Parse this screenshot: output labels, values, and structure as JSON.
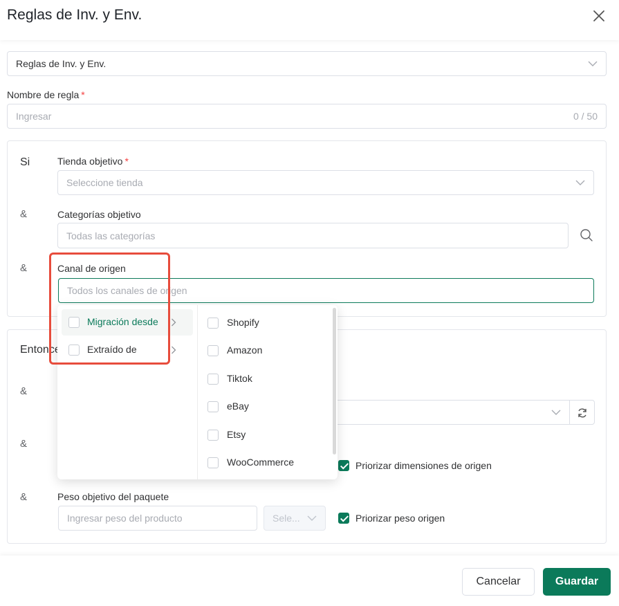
{
  "modal": {
    "title": "Reglas de Inv. y Env."
  },
  "rule_type": {
    "value": "Reglas de Inv. y Env."
  },
  "rule_name": {
    "label": "Nombre de regla",
    "required_mark": "*",
    "placeholder": "Ingresar",
    "counter": "0 / 50"
  },
  "if_section": {
    "label": "Si",
    "store": {
      "label": "Tienda objetivo",
      "required_mark": "*",
      "placeholder": "Seleccione tienda"
    },
    "categories": {
      "prefix": "&",
      "label": "Categorías objetivo",
      "placeholder": "Todas las categorías"
    },
    "channel": {
      "prefix": "&",
      "label": "Canal de origen",
      "placeholder": "Todos los canales de origen"
    }
  },
  "then_section": {
    "label": "Entonces",
    "row1_prefix": "&",
    "row2_prefix": "&",
    "prioritize_dimensions": {
      "label": "Priorizar dimensiones de origen",
      "checked": true
    },
    "weight": {
      "prefix": "&",
      "label": "Peso objetivo del paquete",
      "placeholder": "Ingresar peso del producto",
      "unit_placeholder": "Sele...",
      "prioritize_label": "Priorizar peso origen",
      "prioritize_checked": true
    }
  },
  "channel_dropdown": {
    "groups": [
      {
        "label": "Migración desde",
        "active": true,
        "checked": false
      },
      {
        "label": "Extraído de",
        "active": false,
        "checked": false
      }
    ],
    "options": [
      {
        "label": "Shopify",
        "checked": false
      },
      {
        "label": "Amazon",
        "checked": false
      },
      {
        "label": "Tiktok",
        "checked": false
      },
      {
        "label": "eBay",
        "checked": false
      },
      {
        "label": "Etsy",
        "checked": false
      },
      {
        "label": "WooCommerce",
        "checked": false
      }
    ]
  },
  "footer": {
    "cancel_label": "Cancelar",
    "save_label": "Guardar"
  },
  "colors": {
    "primary": "#0b7a5a",
    "required": "#f53f3f",
    "highlight": "#e74c3c"
  }
}
